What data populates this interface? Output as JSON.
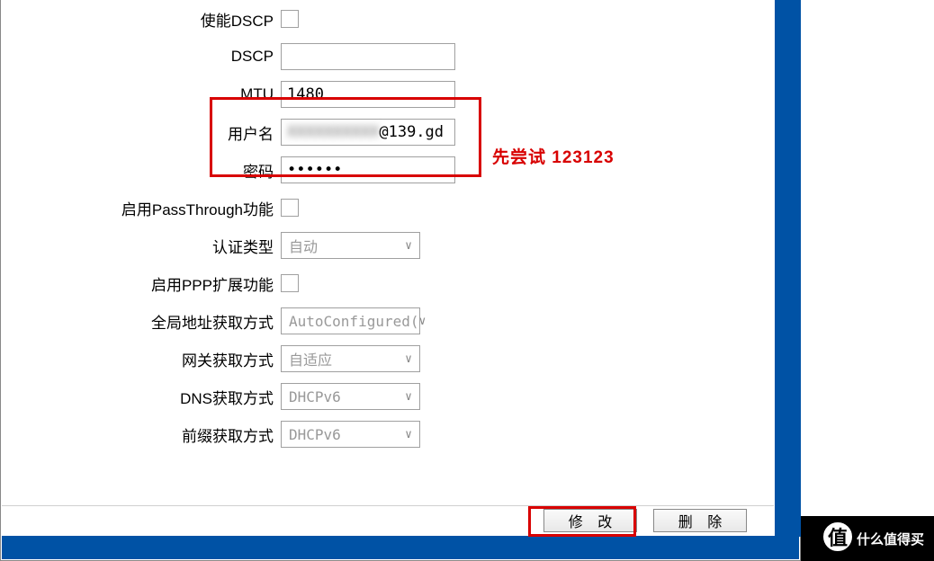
{
  "fields": {
    "enable_dscp": {
      "label": "使能DSCP",
      "checked": false
    },
    "dscp": {
      "label": "DSCP",
      "value": ""
    },
    "mtu": {
      "label": "MTU",
      "value": "1480"
    },
    "username": {
      "label": "用户名",
      "value_blurred": "XXXXXXXXXX",
      "value_suffix": "@139.gd"
    },
    "password": {
      "label": "密码",
      "value": "••••••"
    },
    "passthrough": {
      "label": "启用PassThrough功能",
      "checked": false
    },
    "auth_type": {
      "label": "认证类型",
      "value": "自动"
    },
    "ppp_ext": {
      "label": "启用PPP扩展功能",
      "checked": false
    },
    "global_addr": {
      "label": "全局地址获取方式",
      "value": "AutoConfigured("
    },
    "gateway": {
      "label": "网关获取方式",
      "value": "自适应"
    },
    "dns": {
      "label": "DNS获取方式",
      "value": "DHCPv6"
    },
    "prefix": {
      "label": "前缀获取方式",
      "value": "DHCPv6"
    }
  },
  "annotation": "先尝试  123123",
  "buttons": {
    "modify": "修 改",
    "delete": "删 除"
  },
  "watermark": {
    "badge": "值",
    "text": "什么值得买"
  }
}
